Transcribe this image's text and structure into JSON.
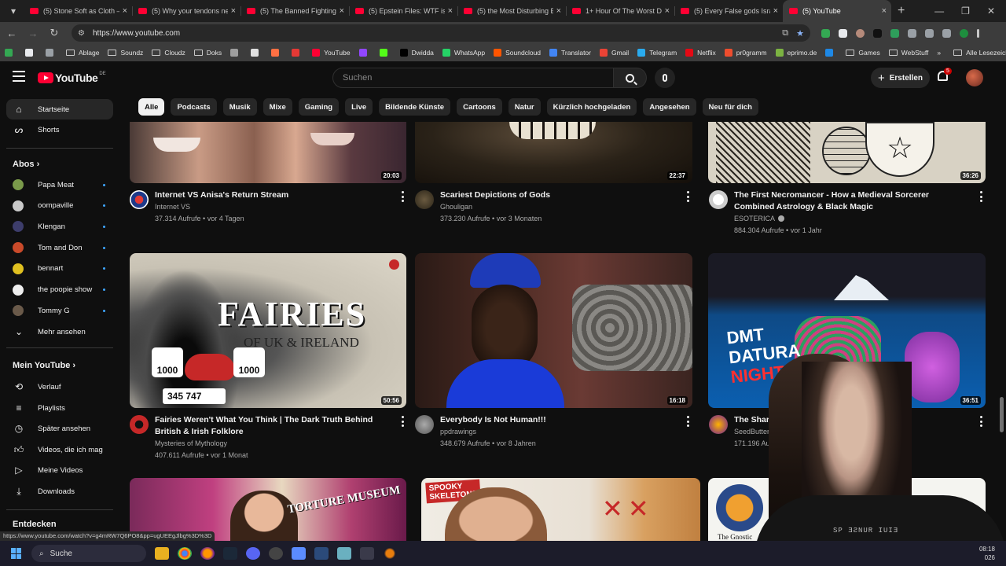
{
  "browser": {
    "tabs": [
      {
        "label": "(5) Stone Soft as Cloth —"
      },
      {
        "label": "(5) Why your tendons nev"
      },
      {
        "label": "(5) The Banned Fighting S"
      },
      {
        "label": "(5) Epstein Files: WTF is a"
      },
      {
        "label": "(5) the Most Disturbing B"
      },
      {
        "label": "1+ Hour Of The Worst De"
      },
      {
        "label": "(5) Every False gods Israe"
      },
      {
        "label": "(5) YouTube"
      }
    ],
    "url": "https://www.youtube.com",
    "bookmarks": [
      {
        "label": "Ablage",
        "kind": "folder"
      },
      {
        "label": "Soundz",
        "kind": "folder"
      },
      {
        "label": "Cloudz",
        "kind": "folder"
      },
      {
        "label": "Doks",
        "kind": "folder"
      },
      {
        "label": "",
        "kind": "icon",
        "color": "#9e9e9e"
      },
      {
        "label": "",
        "kind": "icon",
        "color": "#e0e0e0"
      },
      {
        "label": "",
        "kind": "icon",
        "color": "#ff7043"
      },
      {
        "label": "",
        "kind": "icon",
        "color": "#e53935"
      },
      {
        "label": "YouTube",
        "kind": "icon",
        "color": "#ff0033"
      },
      {
        "label": "",
        "kind": "icon",
        "color": "#9146ff"
      },
      {
        "label": "",
        "kind": "icon",
        "color": "#53fc18"
      },
      {
        "label": "Dwidda",
        "kind": "icon",
        "color": "#000000"
      },
      {
        "label": "WhatsApp",
        "kind": "icon",
        "color": "#25d366"
      },
      {
        "label": "Soundcloud",
        "kind": "icon",
        "color": "#ff5500"
      },
      {
        "label": "Translator",
        "kind": "icon",
        "color": "#4285f4"
      },
      {
        "label": "Gmail",
        "kind": "icon",
        "color": "#ea4335"
      },
      {
        "label": "Telegram",
        "kind": "icon",
        "color": "#2aabee"
      },
      {
        "label": "Netflix",
        "kind": "icon",
        "color": "#e50914"
      },
      {
        "label": "pr0gramm",
        "kind": "icon",
        "color": "#ee4d2e"
      },
      {
        "label": "eprimo.de",
        "kind": "icon",
        "color": "#7cb342"
      },
      {
        "label": "",
        "kind": "icon",
        "color": "#1e88e5"
      },
      {
        "label": "Games",
        "kind": "folder"
      },
      {
        "label": "WebStuff",
        "kind": "folder"
      }
    ],
    "all_bookmarks": "Alle Lesezeichen"
  },
  "yt": {
    "country": "DE",
    "search_placeholder": "Suchen",
    "create_label": "Erstellen",
    "notifications": "5",
    "chips": [
      "Alle",
      "Podcasts",
      "Musik",
      "Mixe",
      "Gaming",
      "Live",
      "Bildende Künste",
      "Cartoons",
      "Natur",
      "Kürzlich hochgeladen",
      "Angesehen",
      "Neu für dich"
    ],
    "sidebar": {
      "home": "Startseite",
      "shorts": "Shorts",
      "subs_header": "Abos",
      "subs": [
        {
          "name": "Papa Meat",
          "color": "#7a9a4a"
        },
        {
          "name": "oompaville",
          "color": "#c9c9c9"
        },
        {
          "name": "Klengan",
          "color": "#3d3d6b"
        },
        {
          "name": "Tom and Don",
          "color": "#c94a2a"
        },
        {
          "name": "bennart",
          "color": "#e0c020"
        },
        {
          "name": "the poopie show",
          "color": "#eeeeee"
        },
        {
          "name": "Tommy G",
          "color": "#6a5a4a"
        }
      ],
      "more": "Mehr ansehen",
      "you_header": "Mein YouTube",
      "you_items": [
        "Verlauf",
        "Playlists",
        "Später ansehen",
        "Videos, die ich mag",
        "Meine Videos",
        "Downloads"
      ],
      "explore_header": "Entdecken"
    },
    "videos": [
      {
        "title": "Internet VS Anisa's Return Stream",
        "channel": "Internet VS",
        "meta": "37.314 Aufrufe • vor 4 Tagen",
        "duration": "20:03",
        "verified": false
      },
      {
        "title": "Scariest Depictions of Gods",
        "channel": "Ghouligan",
        "meta": "373.230 Aufrufe • vor 3 Monaten",
        "duration": "22:37",
        "verified": false
      },
      {
        "title": "The First Necromancer - How a Medieval Sorcerer Combined Astrology & Black Magic",
        "channel": "ESOTERICA",
        "meta": "884.304 Aufrufe • vor 1 Jahr",
        "duration": "36:26",
        "verified": true
      },
      {
        "title": "Fairies Weren't What You Think | The Dark Truth Behind British & Irish Folklore",
        "channel": "Mysteries of Mythology",
        "meta": "407.611 Aufrufe • vor 1 Monat",
        "duration": "50:56",
        "verified": false
      },
      {
        "title": "Everybody Is Not Human!!!",
        "channel": "ppdrawings",
        "meta": "348.679 Aufrufe • vor 8 Jahren",
        "duration": "16:18",
        "verified": false
      },
      {
        "title": "The Shared H",
        "channel": "SeedButter",
        "meta": "171.196 Aufrufe • v",
        "duration": "36:51",
        "verified": true
      }
    ],
    "thumb_text": {
      "fairies": "FAIRIES",
      "fairies_sub": "OF UK & IRELAND",
      "count_a": "1000",
      "count_b": "1000",
      "counter": "345 747",
      "dmt1": "DMT",
      "dmt2": "DATURA",
      "dmt3": "NIGHTMA",
      "spooky1": "SPOOKY",
      "spooky2": "SKELETONS",
      "museum": "TORTURE MUSEUM",
      "gnostic": "The Gnostic"
    }
  },
  "status_url": "https://www.youtube.com/watch?v=g4mRW7Q6PO8&pp=ugUEEgJlbg%3D%3D",
  "taskbar": {
    "search": "Suche",
    "time": "08:18",
    "date": "026"
  }
}
